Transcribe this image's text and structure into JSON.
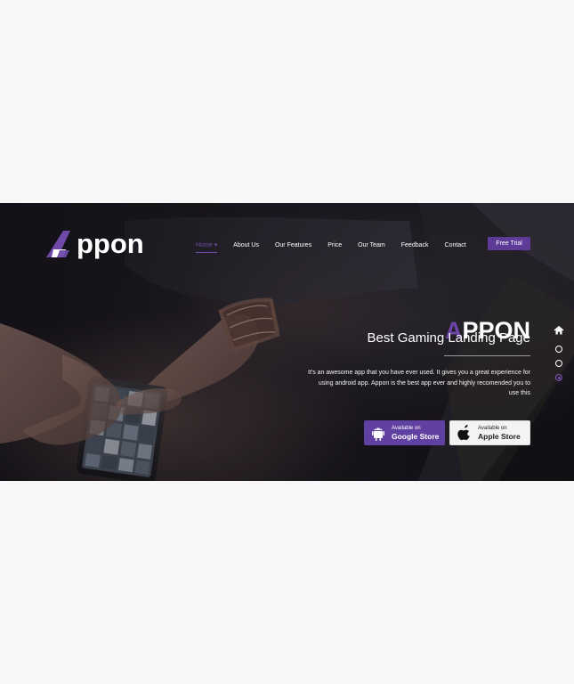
{
  "brand": {
    "logo_text": "ppon",
    "logo_icon": "apex-a-icon",
    "accent_color": "#6e49a7"
  },
  "nav": {
    "items": [
      {
        "label": "Home",
        "active": true
      },
      {
        "label": "About Us",
        "active": false
      },
      {
        "label": "Our Features",
        "active": false
      },
      {
        "label": "Price",
        "active": false
      },
      {
        "label": "Our Team",
        "active": false
      },
      {
        "label": "Feedback",
        "active": false
      },
      {
        "label": "Contact",
        "active": false
      }
    ],
    "home_caret": "▾",
    "cta_label": "Free Trial"
  },
  "hero": {
    "title_first": "A",
    "title_rest": "PPON",
    "subtitle": "Best Gaming Landing Page",
    "description": "It's an awesome app that you have ever used. It gives you a great experience for using android app. Appon is the best app ever and highly recomended you to use this",
    "background_color": "#1a1a1f"
  },
  "stores": [
    {
      "small": "Available on",
      "big": "Google Store",
      "icon": "android-icon",
      "color": "#6040a0"
    },
    {
      "small": "Available on",
      "big": "Apple Store",
      "icon": "apple-icon",
      "color": "#f3f3f3"
    }
  ],
  "side_nav": {
    "home_icon": "home-icon",
    "dots": [
      {
        "active": false
      },
      {
        "active": false
      },
      {
        "active": true
      }
    ]
  }
}
